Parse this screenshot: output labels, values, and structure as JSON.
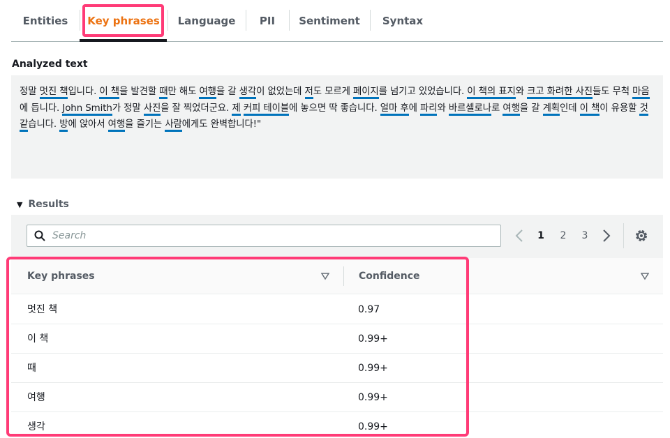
{
  "tabs": [
    {
      "label": "Entities"
    },
    {
      "label": "Key phrases"
    },
    {
      "label": "Language"
    },
    {
      "label": "PII"
    },
    {
      "label": "Sentiment"
    },
    {
      "label": "Syntax"
    }
  ],
  "analyzed": {
    "title": "Analyzed text",
    "segments": [
      {
        "t": "정말 "
      },
      {
        "t": "멋진 책",
        "k": true
      },
      {
        "t": "입니다. "
      },
      {
        "t": "이 책",
        "k": true
      },
      {
        "t": "을 발견할 "
      },
      {
        "t": "때",
        "k": true
      },
      {
        "t": "만 해도 "
      },
      {
        "t": "여행",
        "k": true
      },
      {
        "t": "을 갈 "
      },
      {
        "t": "생각",
        "k": true
      },
      {
        "t": "이 없었는데 "
      },
      {
        "t": "저",
        "k": true
      },
      {
        "t": "도 모르게 "
      },
      {
        "t": "페이지",
        "k": true
      },
      {
        "t": "를 넘기고 있었습니다. "
      },
      {
        "t": "이 책의 표지",
        "k": true
      },
      {
        "t": "와 "
      },
      {
        "t": "크고 화려한 사진",
        "k": true
      },
      {
        "t": "들도 "
      },
      {
        "t": "무척 "
      },
      {
        "t": "마음",
        "k": true
      },
      {
        "t": "에 듭니다. "
      },
      {
        "t": "John Smith",
        "k": true
      },
      {
        "t": "가 정말 "
      },
      {
        "t": "사진",
        "k": true
      },
      {
        "t": "을 잘 찍었더군요. "
      },
      {
        "t": "제",
        "k": true
      },
      {
        "t": " "
      },
      {
        "t": "커피 테이블",
        "k": true
      },
      {
        "t": "에 놓으면 딱 좋습니다. "
      },
      {
        "t": "얼마 후",
        "k": true
      },
      {
        "t": "에 "
      },
      {
        "t": "파리",
        "k": true
      },
      {
        "t": "와 "
      },
      {
        "t": "바르셀로나",
        "k": true
      },
      {
        "t": "로 "
      },
      {
        "t": "여행",
        "k": true
      },
      {
        "t": "을 갈 "
      },
      {
        "t": "계획",
        "k": true
      },
      {
        "t": "인데 "
      },
      {
        "t": "이 책",
        "k": true
      },
      {
        "t": "이 유용할 "
      },
      {
        "t": "것",
        "k": true
      },
      {
        "t": " "
      },
      {
        "t": "같",
        "k": true
      },
      {
        "t": "습니다. "
      },
      {
        "t": "방",
        "k": true
      },
      {
        "t": "에 앉아서 "
      },
      {
        "t": "여행",
        "k": true
      },
      {
        "t": "을 즐기는 "
      },
      {
        "t": "사람",
        "k": true
      },
      {
        "t": "에게도 완벽합니다!\""
      }
    ]
  },
  "results": {
    "title": "Results",
    "search_placeholder": "Search",
    "pages": [
      "1",
      "2",
      "3"
    ],
    "current_page": "1",
    "columns": [
      "Key phrases",
      "Confidence"
    ],
    "rows": [
      {
        "phrase": "멋진 책",
        "confidence": "0.97"
      },
      {
        "phrase": "이 책",
        "confidence": "0.99+"
      },
      {
        "phrase": "때",
        "confidence": "0.99+"
      },
      {
        "phrase": "여행",
        "confidence": "0.99+"
      },
      {
        "phrase": "생각",
        "confidence": "0.99+"
      }
    ]
  },
  "colors": {
    "active_tab": "#ec7211",
    "key_phrase_underline": "#0073bb",
    "annotation_highlight": "#ff3b77"
  }
}
